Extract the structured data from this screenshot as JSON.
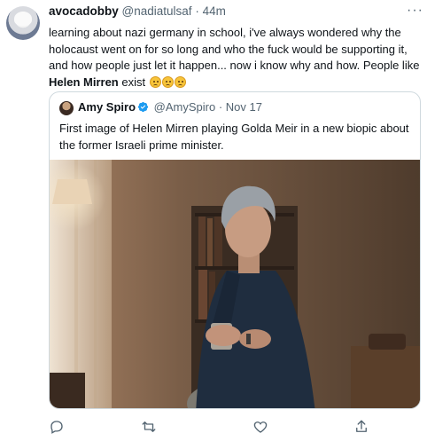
{
  "tweet": {
    "author_name": "avocadobby",
    "author_handle": "@nadiatulsaf",
    "separator": "·",
    "time": "44m",
    "text_before": "learning about nazi germany in school, i've always wondered why the holocaust went on for so long and who the fuck would be supporting it, and how people just let it happen... now i know why and how. People like ",
    "text_bold": "Helen Mirren",
    "text_after": " exist",
    "emoji_name": "worried-face",
    "emoji_count": 3
  },
  "quote": {
    "author_name": "Amy Spiro",
    "author_handle": "@AmySpiro",
    "separator": "·",
    "time": "Nov 17",
    "text": "First image of Helen Mirren playing Golda Meir in a new biopic about the former Israeli prime minister."
  },
  "actions": [
    "reply-icon",
    "retweet-icon",
    "like-icon",
    "share-icon"
  ],
  "colors": {
    "text": "#0f1419",
    "muted": "#536471",
    "border": "#cfd9de",
    "verified": "#1d9bf0"
  }
}
